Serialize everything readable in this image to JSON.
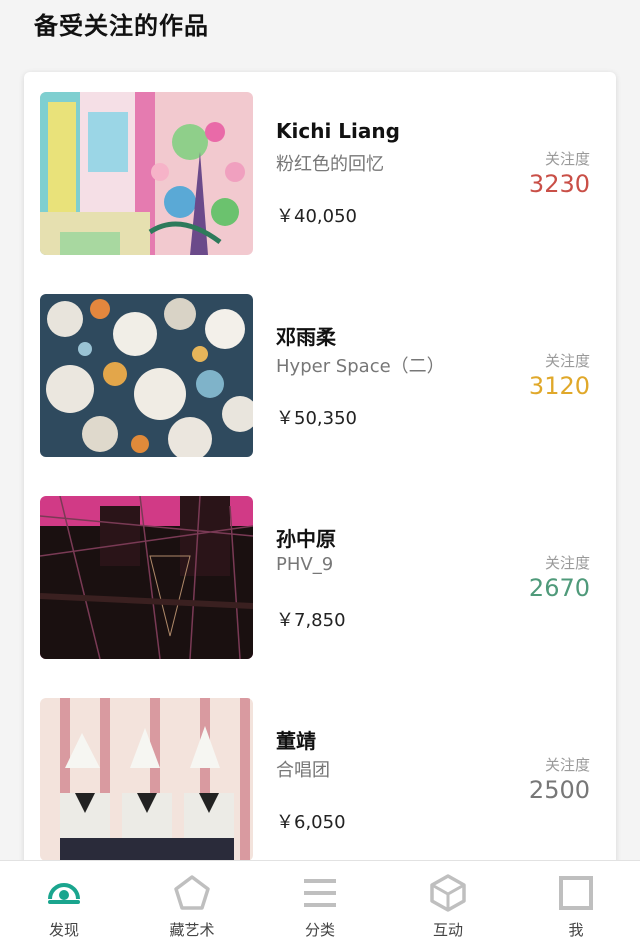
{
  "section_title": "备受关注的作品",
  "attention_label": "关注度",
  "artworks": [
    {
      "artist": "Kichi Liang",
      "title": "粉红色的回忆",
      "price": "￥40,050",
      "attention": "3230",
      "attention_color": "#c94f47"
    },
    {
      "artist": "邓雨柔",
      "title": "Hyper Space（二）",
      "price": "￥50,350",
      "attention": "3120",
      "attention_color": "#e0a82a"
    },
    {
      "artist": "孙中原",
      "title": "PHV_9",
      "price": "￥7,850",
      "attention": "2670",
      "attention_color": "#4f9a7a"
    },
    {
      "artist": "董靖",
      "title": "合唱团",
      "price": "￥6,050",
      "attention": "2500",
      "attention_color": "#777777"
    }
  ],
  "tabbar": {
    "items": [
      {
        "label": "发现",
        "icon": "discover-icon",
        "active": true
      },
      {
        "label": "藏艺术",
        "icon": "pentagon-icon",
        "active": false
      },
      {
        "label": "分类",
        "icon": "menu-lines-icon",
        "active": false
      },
      {
        "label": "互动",
        "icon": "cube-icon",
        "active": false
      },
      {
        "label": "我",
        "icon": "square-icon",
        "active": false
      }
    ],
    "active_color": "#1aa58e",
    "inactive_color": "#bfbfbf"
  }
}
